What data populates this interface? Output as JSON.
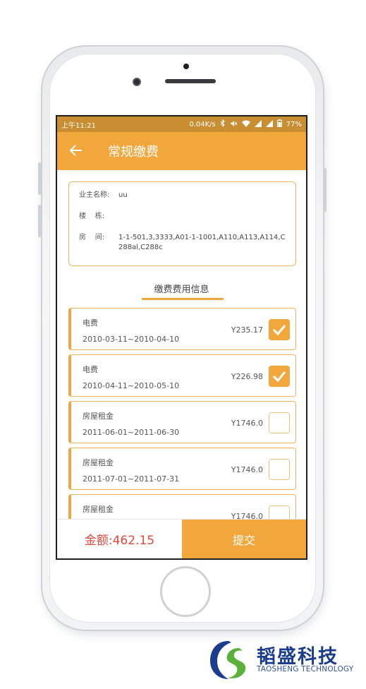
{
  "status_bar": {
    "time": "上午11:21",
    "net_speed": "0.04K/s",
    "battery": "77%"
  },
  "app_bar": {
    "title": "常规缴费"
  },
  "owner_info": {
    "owner_label": "业主名称:",
    "owner_value": "uu",
    "building_label": "楼    栋:",
    "building_value": "",
    "room_label": "房    间:",
    "room_value": "1-1-501,3,3333,A01-1-1001,A110,A113,A114,C288al,C288c"
  },
  "fees_section": {
    "title": "缴费费用信息"
  },
  "fee_items": [
    {
      "name": "电费",
      "period": "2010-03-11~2010-04-10",
      "amount": "Y235.17",
      "checked": true
    },
    {
      "name": "电费",
      "period": "2010-04-11~2010-05-10",
      "amount": "Y226.98",
      "checked": true
    },
    {
      "name": "房屋租金",
      "period": "2011-06-01~2011-06-30",
      "amount": "Y1746.0",
      "checked": false
    },
    {
      "name": "房屋租金",
      "period": "2011-07-01~2011-07-31",
      "amount": "Y1746.0",
      "checked": false
    },
    {
      "name": "房屋租金",
      "period": "",
      "amount": "Y1746.0",
      "checked": false
    }
  ],
  "bottom_bar": {
    "total": "金额:462.15",
    "submit_label": "提交"
  },
  "brand": {
    "name_cn": "韬盛科技",
    "name_en": "TAOSHENG TECHNOLOGY"
  },
  "colors": {
    "accent": "#f2a73d",
    "status_bar": "#c98d32",
    "total_text": "#e8453c",
    "brand_blue": "#1b3d8f",
    "brand_green": "#5bb13a"
  },
  "icons": [
    "back-arrow-icon",
    "bluetooth-icon",
    "mute-icon",
    "wifi-icon",
    "signal-icon",
    "battery-icon",
    "checkmark-icon"
  ]
}
